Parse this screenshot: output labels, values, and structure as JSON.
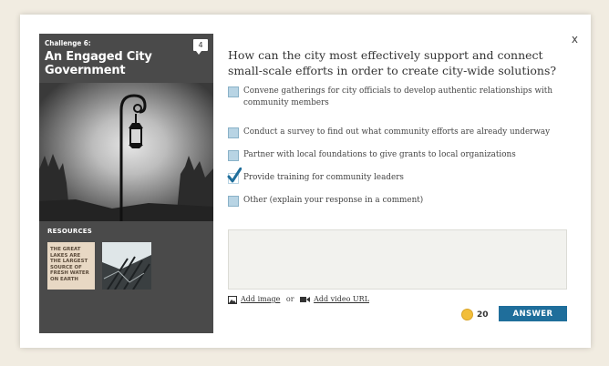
{
  "challenge": {
    "label": "Challenge 6:",
    "title_line1": "An Engaged City",
    "title_line2": "Government",
    "comment_count": "4",
    "resources_label": "RESOURCES",
    "resource1_text": "THE GREAT LAKES ARE THE LARGEST SOURCE OF FRESH WATER ON EARTH"
  },
  "question": {
    "text": "How can the city most effectively support and connect small-scale efforts in order to create city-wide solutions?",
    "options": [
      {
        "label": "Convene gatherings for city officials to develop authentic relationships with community members",
        "checked": false
      },
      {
        "label": "Conduct a survey to find out what community efforts are already underway",
        "checked": false
      },
      {
        "label": "Partner with local foundations to give grants to local organizations",
        "checked": false
      },
      {
        "label": "Provide training for community leaders",
        "checked": true
      },
      {
        "label": "Other (explain your response in a comment)",
        "checked": false
      }
    ]
  },
  "comment": {
    "value": "",
    "placeholder": ""
  },
  "media": {
    "add_image": "Add image",
    "or": "or",
    "add_video": "Add video URL"
  },
  "footer": {
    "points": "20",
    "answer_label": "ANSWER"
  },
  "close_label": "x",
  "colors": {
    "accent": "#1f6e9b",
    "checkbox": "#b8d4e4",
    "check_mark": "#1f6e9b",
    "coin": "#f2be3a",
    "card_bg": "#4a4a4a"
  }
}
